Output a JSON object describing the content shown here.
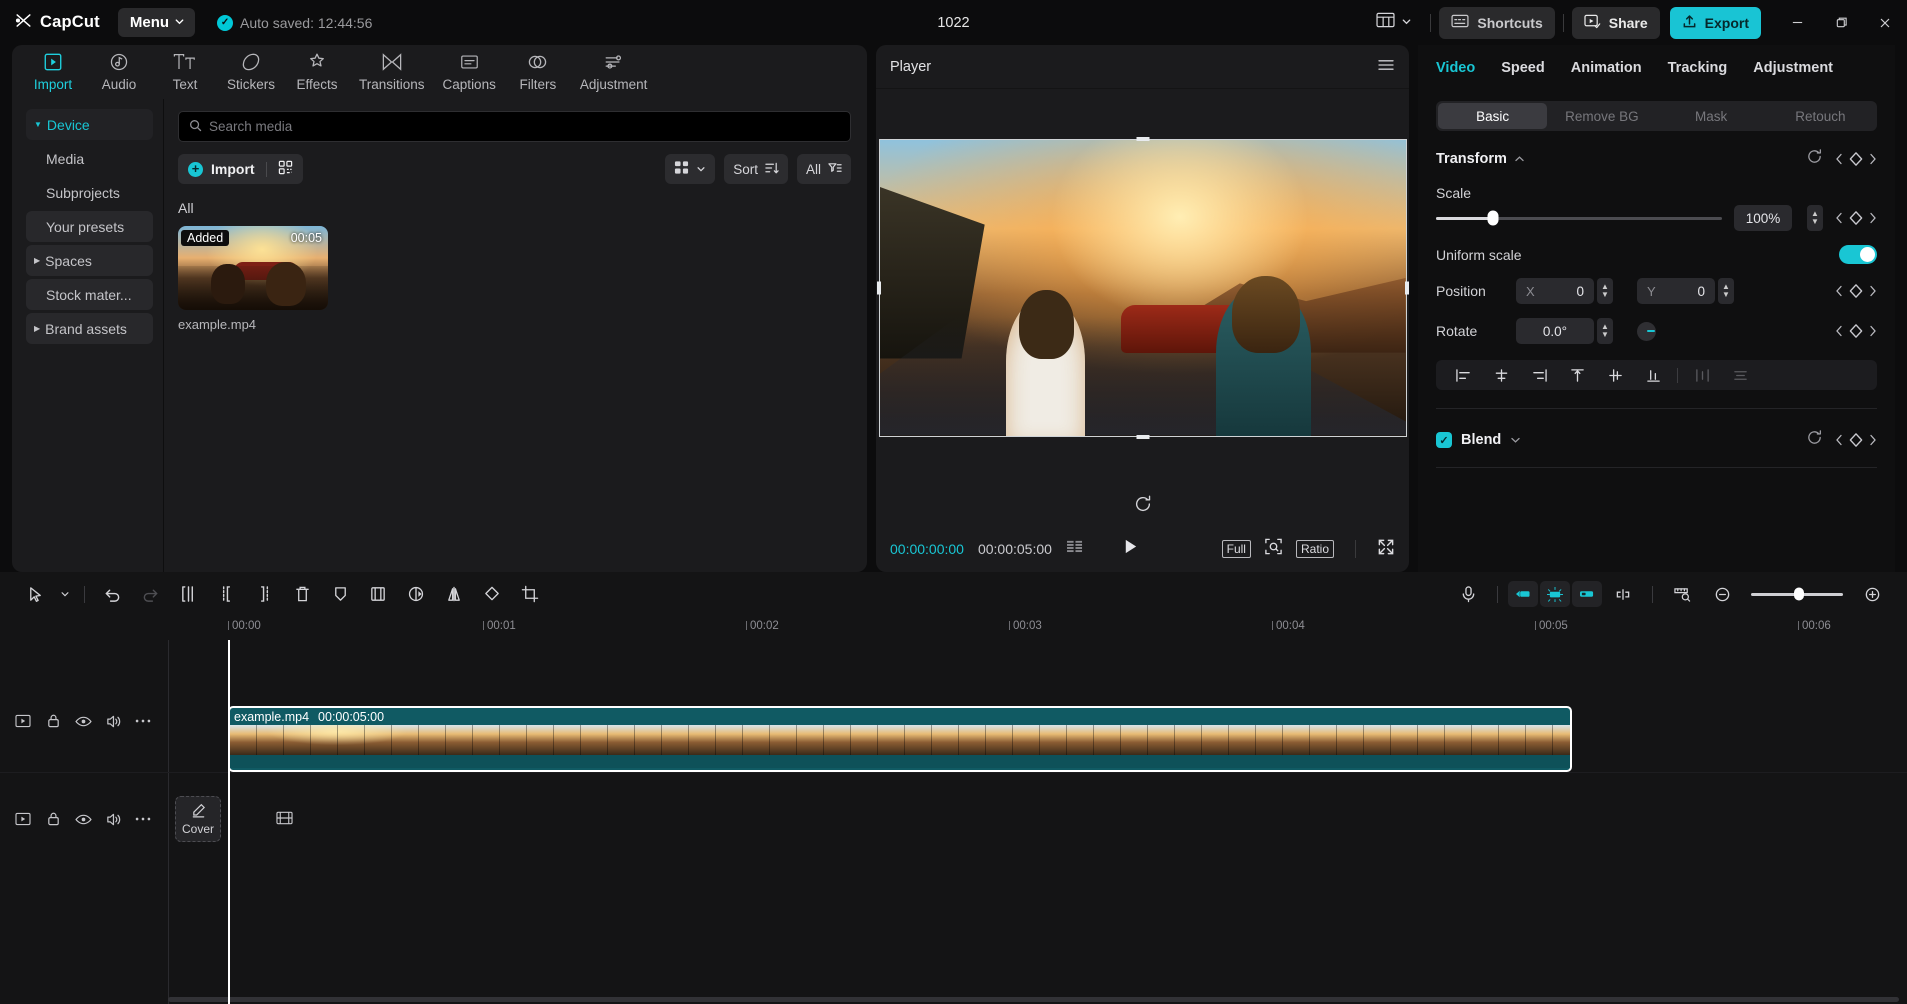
{
  "titlebar": {
    "brand": "CapCut",
    "menu_label": "Menu",
    "autosave": "Auto saved: 12:44:56",
    "project_title": "1022",
    "shortcuts_label": "Shortcuts",
    "share_label": "Share",
    "export_label": "Export",
    "minimize": "–",
    "maximize": "❐",
    "close": "✕"
  },
  "tabs": [
    {
      "label": "Import",
      "icon": "import-icon",
      "active": true
    },
    {
      "label": "Audio",
      "icon": "audio-icon",
      "active": false
    },
    {
      "label": "Text",
      "icon": "text-icon",
      "active": false
    },
    {
      "label": "Stickers",
      "icon": "stickers-icon",
      "active": false
    },
    {
      "label": "Effects",
      "icon": "effects-icon",
      "active": false
    },
    {
      "label": "Transitions",
      "icon": "transitions-icon",
      "active": false
    },
    {
      "label": "Captions",
      "icon": "captions-icon",
      "active": false
    },
    {
      "label": "Filters",
      "icon": "filters-icon",
      "active": false
    },
    {
      "label": "Adjustment",
      "icon": "adjustment-icon",
      "active": false
    }
  ],
  "nav": {
    "items": [
      {
        "label": "Device",
        "type": "group",
        "expanded": true
      },
      {
        "label": "Media",
        "type": "sub"
      },
      {
        "label": "Subprojects",
        "type": "sub"
      },
      {
        "label": "Your presets",
        "type": "sub",
        "selected": true
      },
      {
        "label": "Spaces",
        "type": "group",
        "expanded": false
      },
      {
        "label": "Stock mater...",
        "type": "sub"
      },
      {
        "label": "Brand assets",
        "type": "group",
        "expanded": false
      }
    ]
  },
  "browser": {
    "search_placeholder": "Search media",
    "search_value": "",
    "import_label": "Import",
    "view_label": "",
    "sort_label": "Sort",
    "filter_label": "All",
    "section_label": "All",
    "items": [
      {
        "name": "example.mp4",
        "badge": "Added",
        "duration": "00:05"
      }
    ]
  },
  "player": {
    "title": "Player",
    "current_time": "00:00:00:00",
    "total_time": "00:00:05:00",
    "full_label": "Full",
    "ratio_label": "Ratio"
  },
  "inspector": {
    "tabs": [
      {
        "label": "Video",
        "active": true
      },
      {
        "label": "Speed",
        "active": false
      },
      {
        "label": "Animation",
        "active": false
      },
      {
        "label": "Tracking",
        "active": false
      },
      {
        "label": "Adjustment",
        "active": false
      }
    ],
    "segments": [
      {
        "label": "Basic",
        "active": true
      },
      {
        "label": "Remove BG",
        "active": false
      },
      {
        "label": "Mask",
        "active": false
      },
      {
        "label": "Retouch",
        "active": false
      }
    ],
    "transform": {
      "title": "Transform",
      "scale_label": "Scale",
      "scale_value": "100%",
      "uniform_label": "Uniform scale",
      "uniform_on": true,
      "position_label": "Position",
      "pos_x_axis": "X",
      "pos_x_value": "0",
      "pos_y_axis": "Y",
      "pos_y_value": "0",
      "rotate_label": "Rotate",
      "rotate_value": "0.0°"
    },
    "blend": {
      "title": "Blend",
      "enabled": true
    }
  },
  "timeline": {
    "ruler_ticks": [
      "00:00",
      "00:01",
      "00:02",
      "00:03",
      "00:04",
      "00:05",
      "00:06"
    ],
    "cover_label": "Cover",
    "clip": {
      "name": "example.mp4",
      "duration": "00:00:05:00"
    }
  }
}
